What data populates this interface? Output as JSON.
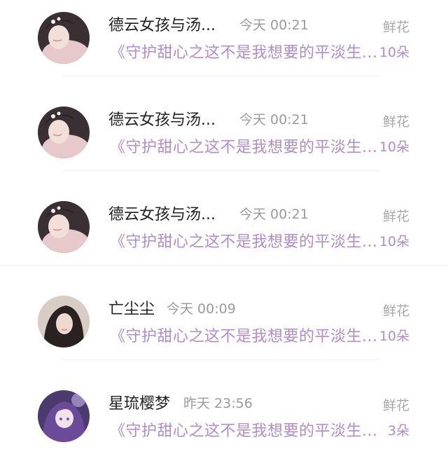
{
  "colors": {
    "accent_purple": "#b08ccc",
    "name_text": "#222222",
    "meta_gray": "#9a9a9a"
  },
  "rows": [
    {
      "avatar_icon": "avatar-portrait-icon",
      "name": "德云女孩与汤...",
      "time": "今天 00:21",
      "work": "《守护甜心之这不是我想要的平淡生...",
      "gift_type": "鲜花",
      "gift_count": "10朵"
    },
    {
      "avatar_icon": "avatar-portrait-icon",
      "name": "德云女孩与汤...",
      "time": "今天 00:21",
      "work": "《守护甜心之这不是我想要的平淡生...",
      "gift_type": "鲜花",
      "gift_count": "10朵"
    },
    {
      "avatar_icon": "avatar-portrait-icon",
      "name": "德云女孩与汤...",
      "time": "今天 00:21",
      "work": "《守护甜心之这不是我想要的平淡生...",
      "gift_type": "鲜花",
      "gift_count": "10朵"
    },
    {
      "avatar_icon": "avatar-portrait-icon",
      "name": "亡尘尘",
      "time": "今天 00:09",
      "work": "《守护甜心之这不是我想要的平淡生...",
      "gift_type": "鲜花",
      "gift_count": "10朵"
    },
    {
      "avatar_icon": "avatar-anime-icon",
      "name": "星琉樱梦",
      "time": "昨天 23:56",
      "work": "《守护甜心之这不是我想要的平淡生...",
      "gift_type": "鲜花",
      "gift_count": "3朵"
    }
  ]
}
